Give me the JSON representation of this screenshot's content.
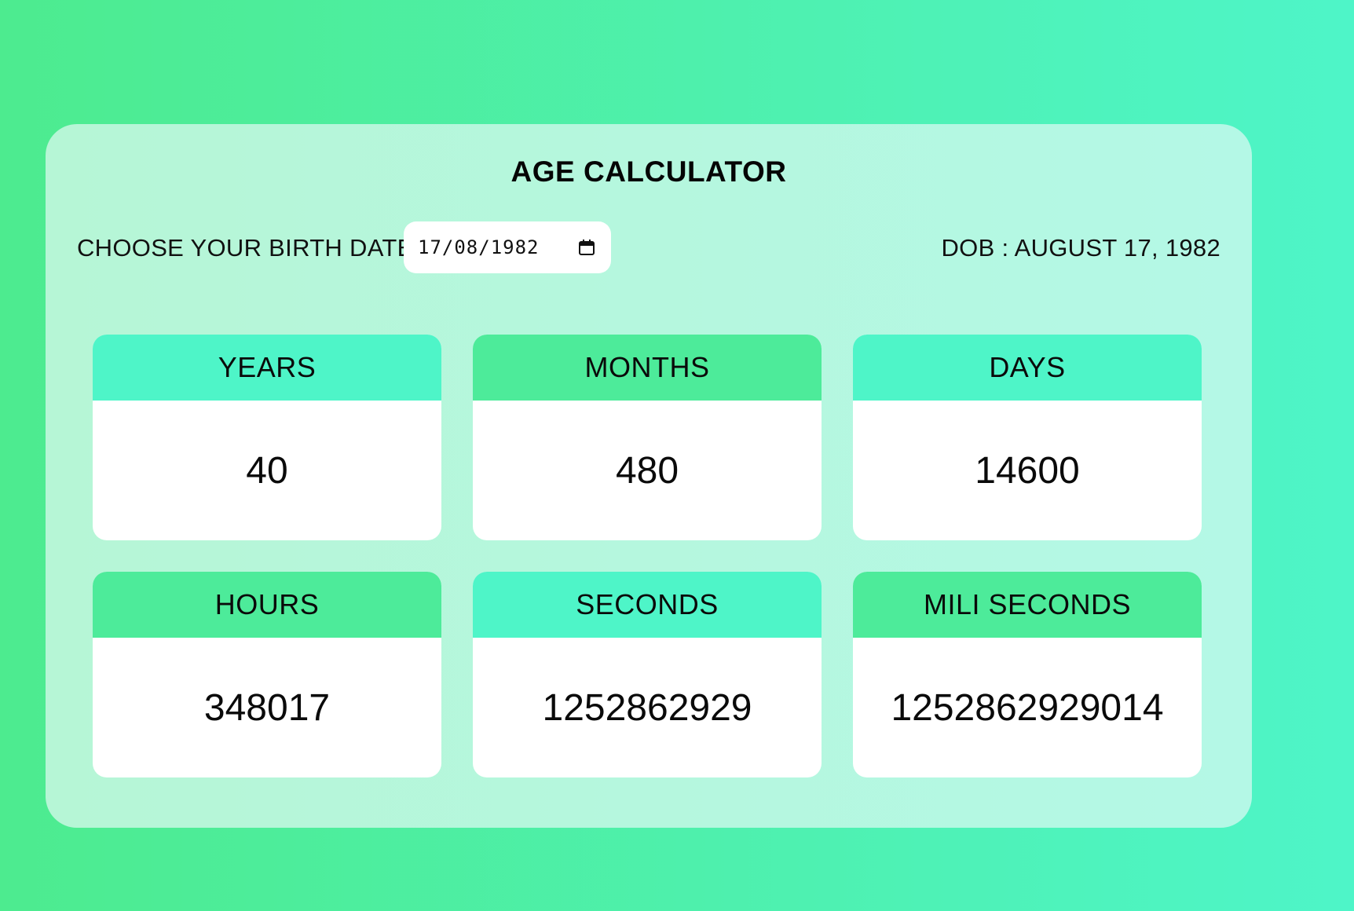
{
  "app": {
    "title": "AGE CALCULATOR"
  },
  "birth": {
    "label": "CHOOSE YOUR BIRTH DATE",
    "input_value": "17/08/1982",
    "dob_text": "DOB : AUGUST 17, 1982"
  },
  "icons": {
    "date_picker": "calendar-icon"
  },
  "colors": {
    "accent_cyan": "#4ef5c8",
    "accent_green": "#4deb9a",
    "card_bg": "#b6f6d6"
  },
  "results": [
    {
      "label": "YEARS",
      "value": "40"
    },
    {
      "label": "MONTHS",
      "value": "480"
    },
    {
      "label": "DAYS",
      "value": "14600"
    },
    {
      "label": "HOURS",
      "value": "348017"
    },
    {
      "label": "SECONDS",
      "value": "1252862929"
    },
    {
      "label": "MILI SECONDS",
      "value": "1252862929014"
    }
  ]
}
